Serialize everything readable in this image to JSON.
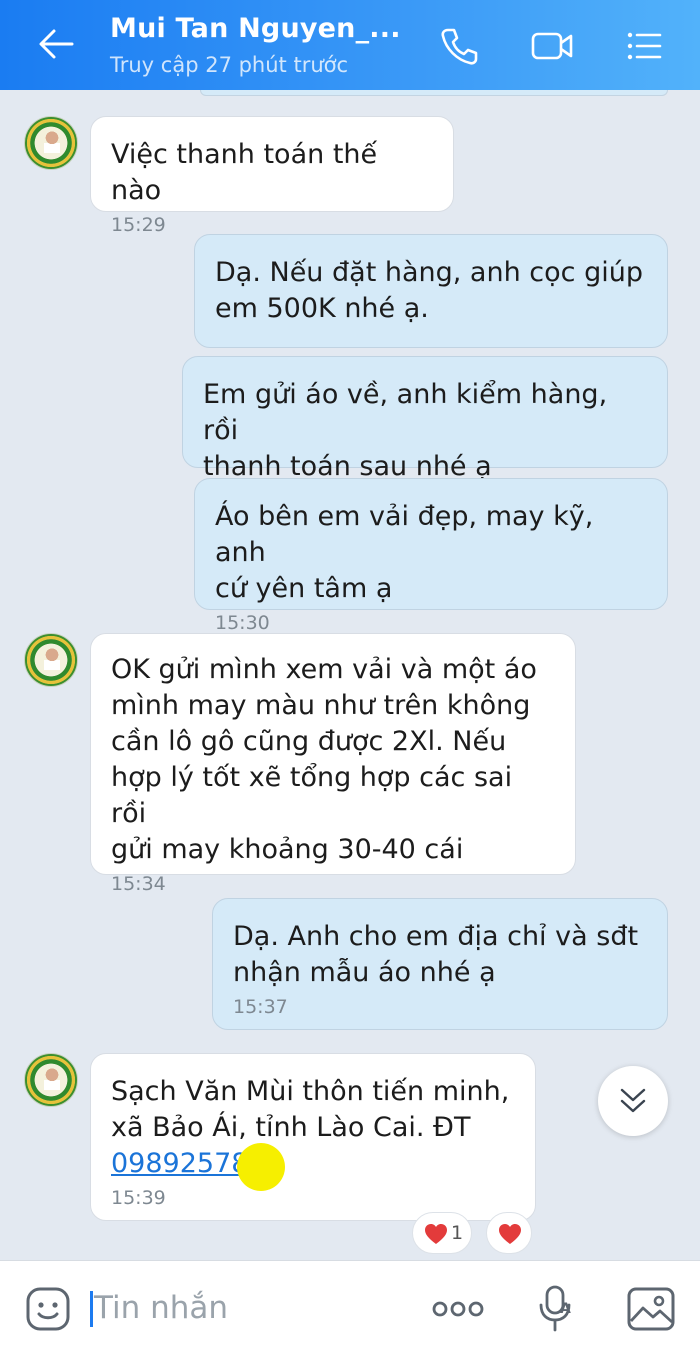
{
  "header": {
    "contact_name": "Mui Tan Nguyen_...",
    "status": "Truy cập 27 phút trước"
  },
  "messages": [
    {
      "side": "in",
      "text": "Việc thanh toán thế nào",
      "time": "15:29"
    },
    {
      "side": "out",
      "text": "Dạ. Nếu đặt hàng, anh cọc giúp em 500K nhé ạ.",
      "time": ""
    },
    {
      "side": "out",
      "text": "Em gửi áo về, anh kiểm hàng, rồi thanh toán sau nhé ạ",
      "time": ""
    },
    {
      "side": "out",
      "text": "Áo bên em vải đẹp, may kỹ, anh cứ yên tâm ạ",
      "time": "15:30"
    },
    {
      "side": "in",
      "text": "OK gửi mình xem vải và một áo mình may màu như trên không cần lô gô cũng được 2Xl. Nếu hợp lý tốt xẽ tổng hợp các sai rồi gửi may khoảng 30-40 cái",
      "time": "15:34"
    },
    {
      "side": "out",
      "text": "Dạ. Anh cho em địa chỉ và sđt nhận mẫu áo nhé ạ",
      "time": "15:37"
    },
    {
      "side": "in",
      "text": "Sạch Văn Mùi thôn tiến minh, xã Bảo Ái, tỉnh Lào Cai. ĐT",
      "phone": "09892578",
      "time": "15:39"
    }
  ],
  "m1_l1": "Việc thanh toán thế nào",
  "m2_l1": "Dạ. Nếu đặt hàng, anh cọc giúp",
  "m2_l2": "em 500K nhé ạ.",
  "m3_l1": "Em gửi áo về, anh kiểm hàng, rồi",
  "m3_l2": "thanh toán sau nhé ạ",
  "m4_l1": "Áo bên em vải đẹp, may kỹ, anh",
  "m4_l2": "cứ yên tâm ạ",
  "m5_l1": "OK gửi mình xem vải và một áo",
  "m5_l2": "mình may màu như trên không",
  "m5_l3": "cần lô gô cũng được 2Xl. Nếu",
  "m5_l4": "hợp lý tốt xẽ tổng hợp các sai rồi",
  "m5_l5": "gửi may khoảng 30-40 cái",
  "m6_l1": "Dạ. Anh cho em địa chỉ và sđt",
  "m6_l2": "nhận mẫu áo nhé ạ",
  "m7_l1": "Sạch Văn Mùi thôn tiến minh,",
  "m7_l2": "xã Bảo Ái, tỉnh Lào Cai. ĐT",
  "reactions": {
    "heart_count": "1"
  },
  "input": {
    "placeholder": "Tin nhắn"
  },
  "colors": {
    "header_start": "#1a7cf2",
    "header_end": "#52b2fa",
    "out_bubble": "#d5eaf8",
    "link": "#1b74d8"
  }
}
